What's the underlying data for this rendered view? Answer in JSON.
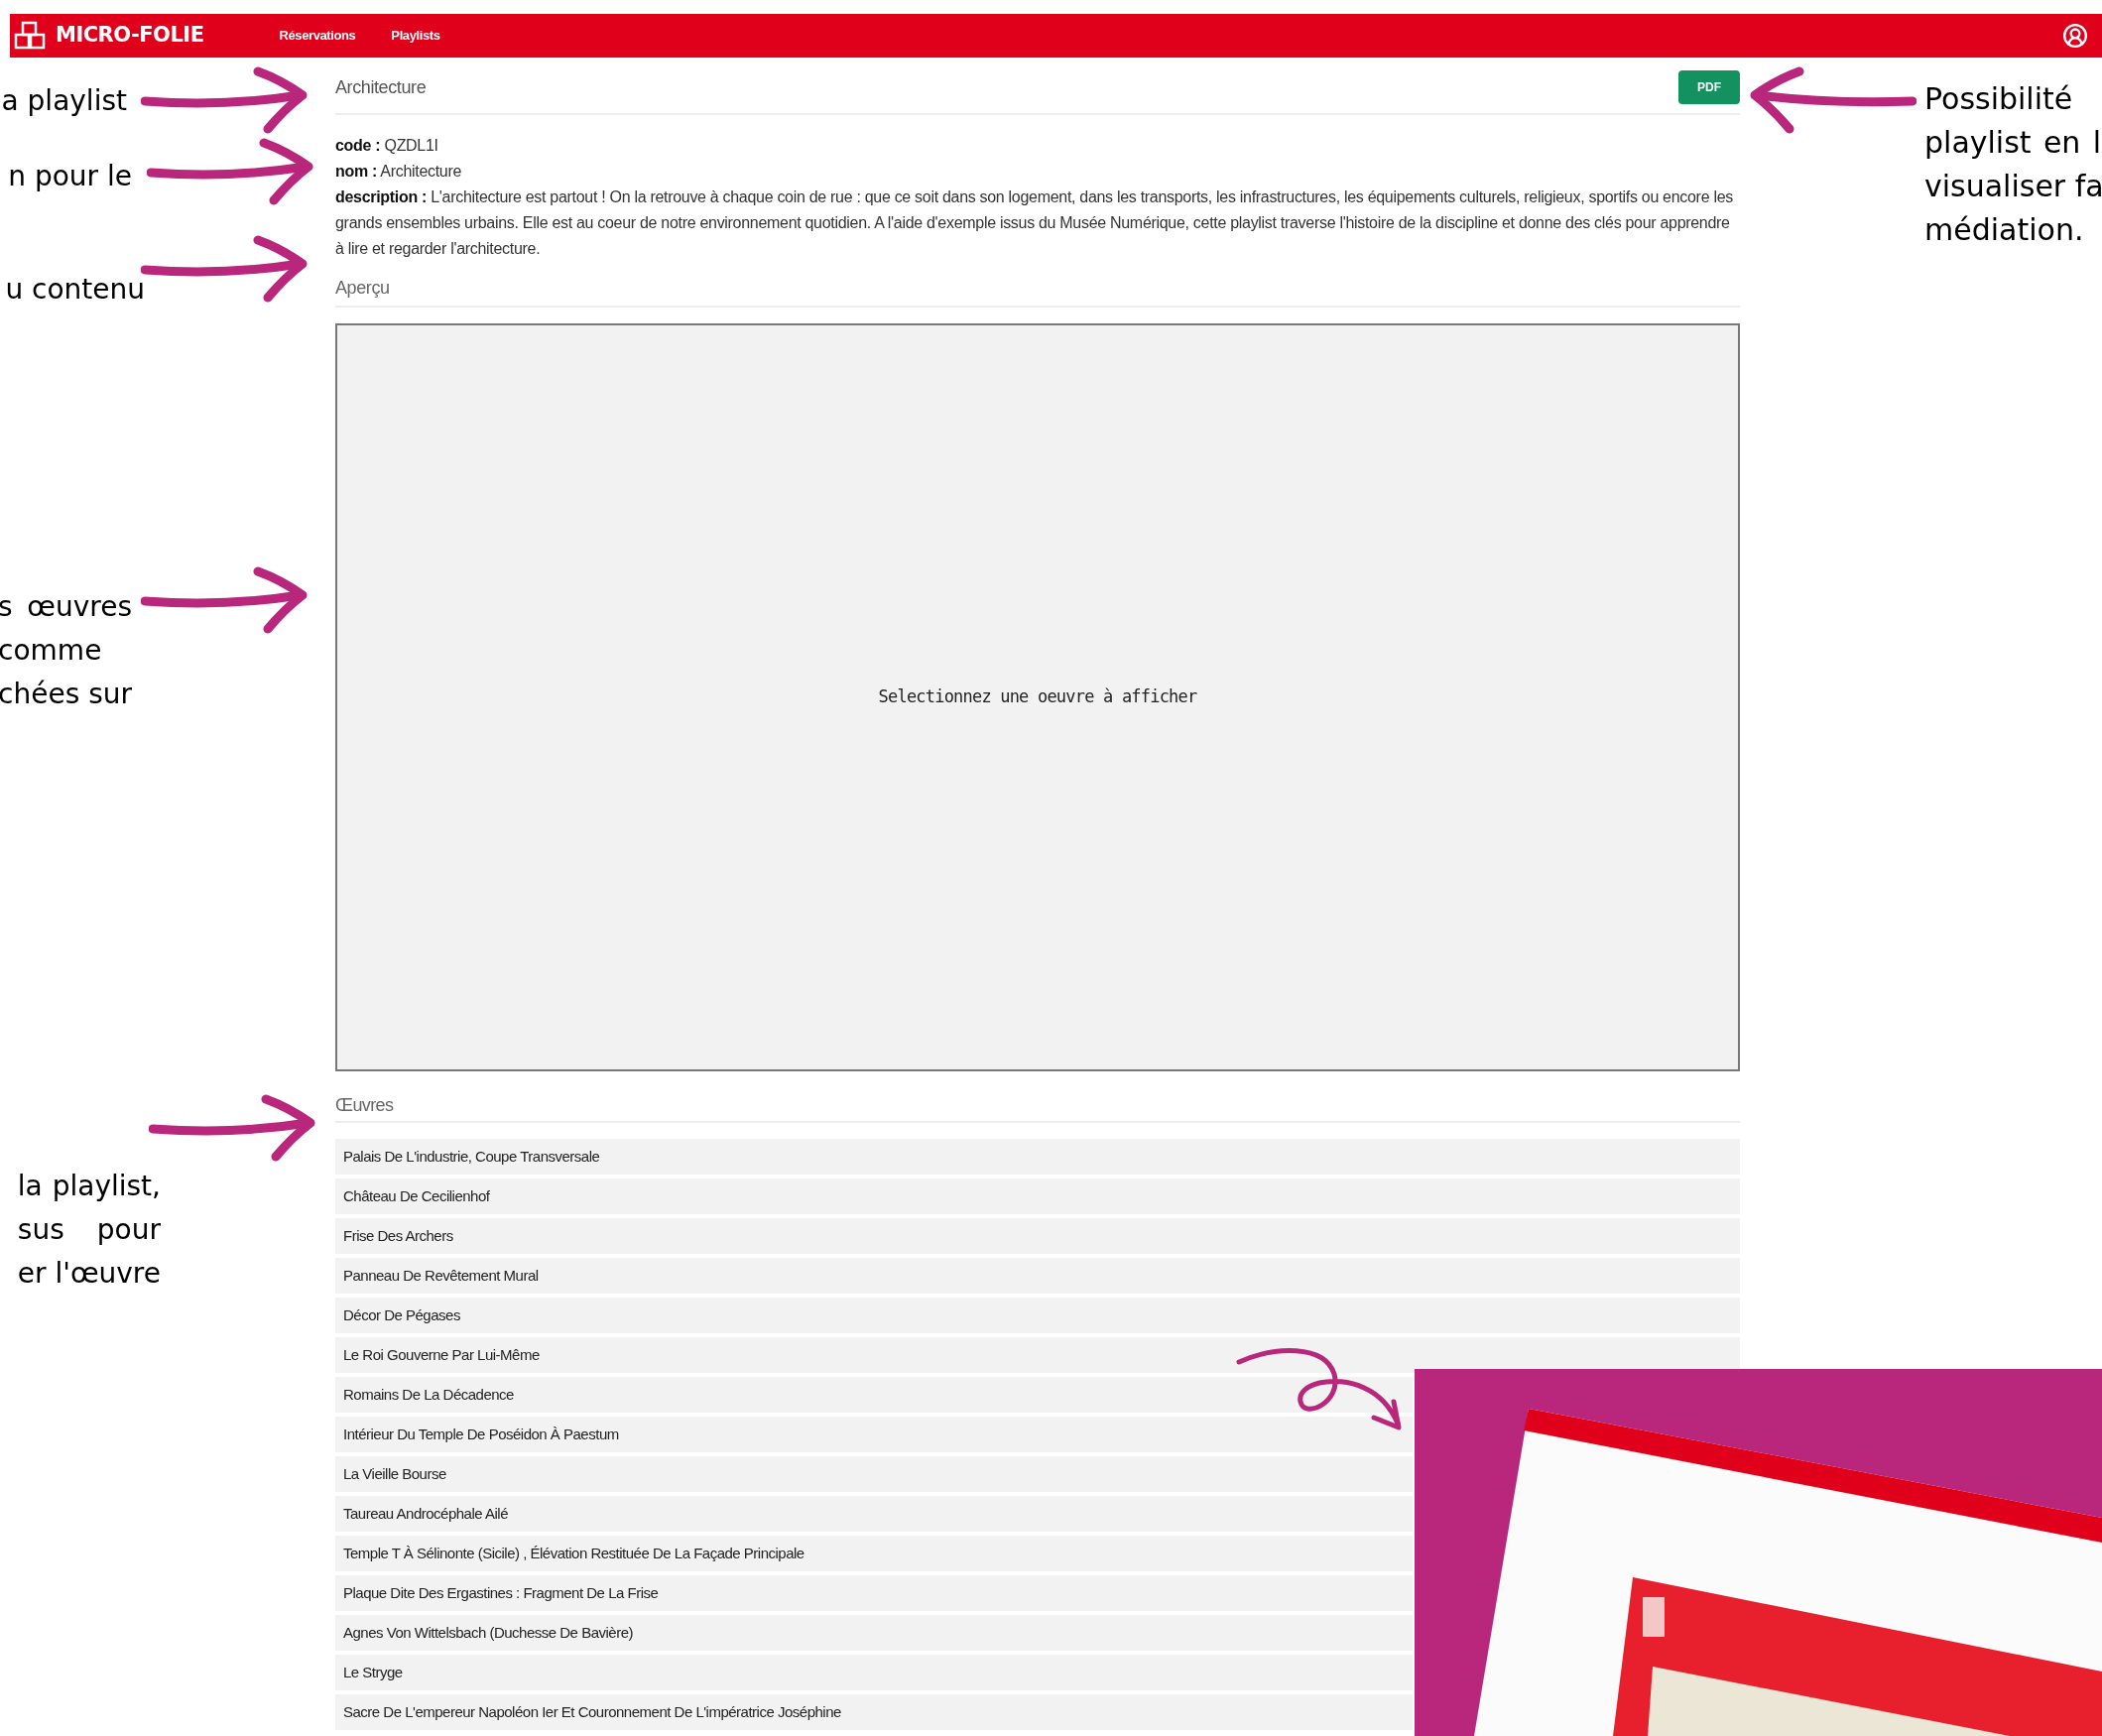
{
  "navbar": {
    "logo": "MICRO-FOLIE",
    "links": [
      {
        "label": "Réservations"
      },
      {
        "label": "Playlists"
      }
    ]
  },
  "playlist": {
    "title": "Architecture",
    "pdf_button": "PDF",
    "fields": [
      {
        "label": "code :",
        "value": "QZDL1I"
      },
      {
        "label": "nom :",
        "value": "Architecture"
      },
      {
        "label": "description :",
        "value": "L'architecture est partout ! On la retrouve à chaque coin de rue : que ce soit dans son logement, dans les transports, les infrastructures, les équipements culturels, religieux, sportifs ou encore les grands ensembles urbains. Elle est au coeur de notre environnement quotidien. A l'aide d'exemple issus du Musée Numérique, cette playlist traverse l'histoire de la discipline et donne des clés pour apprendre à lire et regarder l'architecture."
      }
    ],
    "preview_heading": "Aperçu",
    "preview_placeholder": "Selectionnez une oeuvre à afficher",
    "works_heading": "Œuvres",
    "works": [
      "Palais De L'industrie, Coupe Transversale",
      "Château De Cecilienhof",
      "Frise Des Archers",
      "Panneau De Revêtement Mural",
      "Décor De Pégases",
      "Le Roi Gouverne Par Lui-Même",
      "Romains De La Décadence",
      "Intérieur Du Temple De Poséidon À Paestum",
      "La Vieille Bourse",
      "Taureau Androcéphale Ailé",
      "Temple T À Sélinonte (Sicile) , Élévation Restituée De La Façade Principale",
      "Plaque Dite Des Ergastines : Fragment De La Frise",
      "Agnes Von Wittelsbach (Duchesse De Bavière)",
      "Le Stryge",
      "Sacre De L'empereur Napoléon Ier Et Couronnement De L'impératrice Joséphine"
    ]
  },
  "annotations_left": [
    {
      "lines": [
        "a playlist"
      ]
    },
    {
      "lines": [
        "n pour le"
      ]
    },
    {
      "lines": [
        "u contenu"
      ]
    },
    {
      "lines": [
        "s œuvres",
        "comme",
        "chées sur"
      ]
    },
    {
      "lines": [
        "la playlist,",
        "sus pour",
        "er l'œuvre"
      ]
    }
  ],
  "annotation_right": {
    "lines": [
      "Possibilité",
      "playlist en l",
      "visualiser fa",
      "médiation."
    ]
  }
}
